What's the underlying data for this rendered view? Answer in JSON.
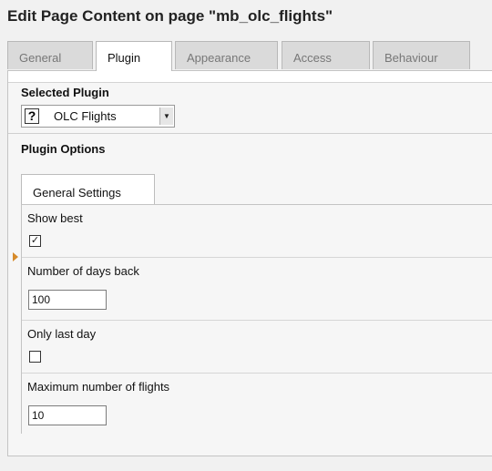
{
  "page": {
    "title": "Edit Page Content on page \"mb_olc_flights\""
  },
  "tabs": [
    {
      "label": "General",
      "active": false
    },
    {
      "label": "Plugin",
      "active": true
    },
    {
      "label": "Appearance",
      "active": false
    },
    {
      "label": "Access",
      "active": false
    },
    {
      "label": "Behaviour",
      "active": false
    }
  ],
  "plugin": {
    "selected_label": "Selected Plugin",
    "selected_value": "OLC Flights",
    "icon": "plugin-question-icon",
    "options_label": "Plugin Options"
  },
  "settings_tab": {
    "label": "General Settings"
  },
  "fields": {
    "show_best": {
      "label": "Show best",
      "checked": true,
      "mark": "✓"
    },
    "days_back": {
      "label": "Number of days back",
      "value": "100"
    },
    "only_last_day": {
      "label": "Only last day",
      "checked": false,
      "mark": ""
    },
    "max_flights": {
      "label": "Maximum number of flights",
      "value": "10"
    }
  },
  "colors": {
    "marker": "#d68a2a",
    "panel_bg": "#f6f6f6"
  }
}
